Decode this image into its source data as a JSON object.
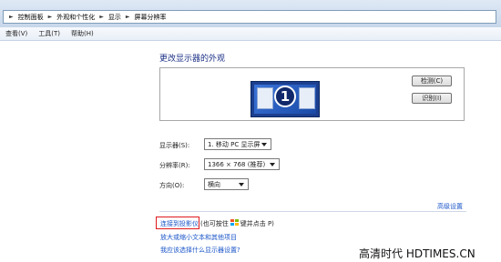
{
  "breadcrumb": {
    "items": [
      "控制面板",
      "外观和个性化",
      "显示",
      "屏幕分辨率"
    ],
    "separator": "►"
  },
  "menu": [
    "查看(V)",
    "工具(T)",
    "帮助(H)"
  ],
  "page_title": "更改显示器的外观",
  "preview": {
    "monitor_number": "1",
    "detect_label": "检测(C)",
    "identify_label": "识别(I)"
  },
  "settings": {
    "display_label": "显示器(S):",
    "display_value": "1. 移动 PC 显示屏",
    "resolution_label": "分辨率(R):",
    "resolution_value": "1366 × 768 (推荐)",
    "orientation_label": "方向(O):",
    "orientation_value": "横向"
  },
  "advanced_link": "高级设置",
  "projector": {
    "link": "连接到投影仪",
    "hint_before": "(也可按住",
    "hint_after": "键并点击 P)"
  },
  "links": {
    "text_size": "放大或缩小文本和其他项目",
    "which_settings": "我应该选择什么显示器设置?"
  },
  "watermark": "高清时代 HDTIMES.CN"
}
